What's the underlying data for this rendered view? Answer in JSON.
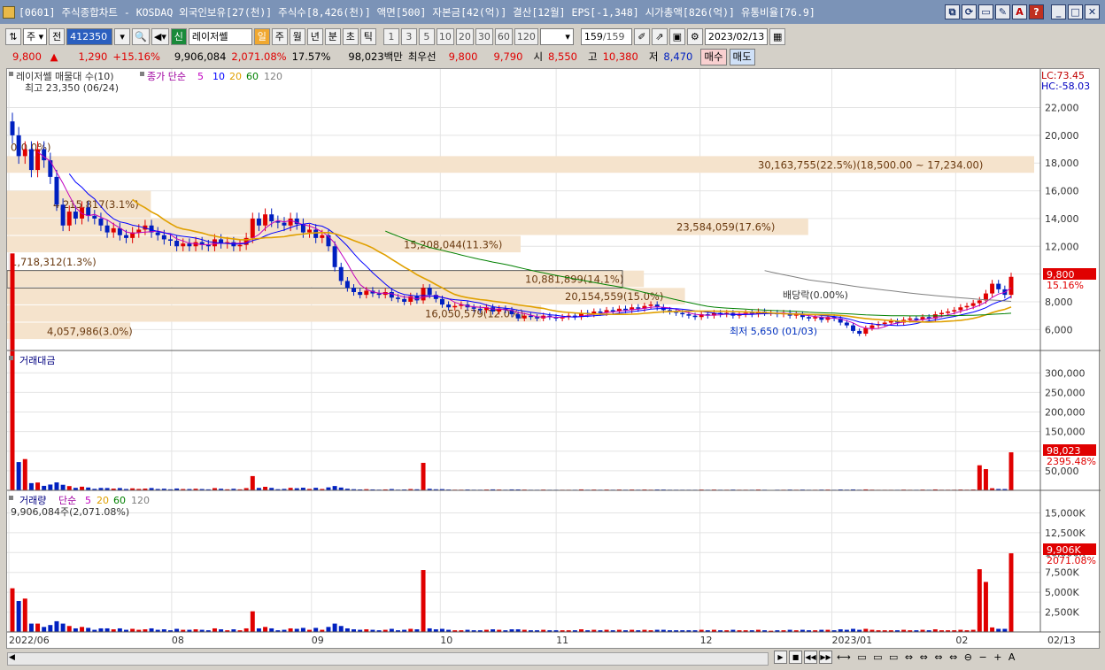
{
  "window": {
    "title": "[0601] 주식종합차트 - KOSDAQ 외국인보유[27(천)] 주식수[8,426(천)] 액면[500] 자본금[42(억)] 결산[12월] EPS[-1,348] 시가총액[826(억)] 유통비율[76.9]",
    "buttons": [
      "⧉",
      "⟳",
      "▭",
      "✎",
      "A",
      "?",
      "_",
      "□",
      "✕"
    ]
  },
  "toolbar": {
    "type_select": "주",
    "prev_label": "전",
    "code": "412350",
    "badge": "신",
    "stock_name": "레이저쎌",
    "periods": [
      "일",
      "주",
      "월",
      "년",
      "분",
      "초",
      "틱"
    ],
    "intervals": [
      "1",
      "3",
      "5",
      "10",
      "20",
      "30",
      "60",
      "120"
    ],
    "count": "159",
    "total": "/159",
    "date": "2023/02/13"
  },
  "quote": {
    "price": "9,800",
    "arrow": "▲",
    "change": "1,290",
    "change_pct": "+15.16%",
    "volume": "9,906,084",
    "volume_pct": "2,071.08%",
    "turnover": "17.57%",
    "amount": "98,023백만",
    "best_label": "최우선",
    "best_ask": "9,800",
    "best_bid": "9,790",
    "open_label": "시",
    "open": "8,550",
    "high_label": "고",
    "high": "10,380",
    "low_label": "저",
    "low": "8,470",
    "buy_label": "매수",
    "sell_label": "매도"
  },
  "chart_data": {
    "type": "candlestick",
    "x_labels": [
      "2022/06",
      "08",
      "09",
      "10",
      "11",
      "12",
      "2023/01",
      "02",
      "02/13"
    ],
    "price_panel": {
      "legend_name": "레이저쎌 매물대 수(10)",
      "ma_label": "종가 단순",
      "ma_periods": [
        "5",
        "10",
        "20",
        "60",
        "120"
      ],
      "ma_colors": [
        "#c000c0",
        "#0000ff",
        "#e0a000",
        "#008000",
        "#808080"
      ],
      "y_ticks": [
        "22,000",
        "20,000",
        "18,000",
        "16,000",
        "14,000",
        "12,000",
        "10,000",
        "8,000",
        "6,000"
      ],
      "ylim": [
        5000,
        23500
      ],
      "lc": "LC:73.45",
      "hc": "HC:-58.03",
      "high_note": "최고 23,350 (06/24)",
      "low_note": "최저 5,650 (01/03)",
      "dividend_note": "배당락(0.00%)",
      "last_price": "9,800",
      "last_pct": "15.16%",
      "volume_profile": [
        {
          "label": "30,163,755(22.5%)(18,500.00 ~ 17,234.00)",
          "lo": 17234,
          "hi": 18500
        },
        {
          "label": "23,584,059(17.6%)",
          "lo": 12750,
          "hi": 14000
        },
        {
          "label": "15,208,044(11.3%)",
          "lo": 11500,
          "hi": 12750
        },
        {
          "label": "1,718,312(1.3%)",
          "lo": 10250,
          "hi": 11500
        },
        {
          "label": "10,881,899(14.1%)",
          "lo": 9000,
          "hi": 10250
        },
        {
          "label": "20,154,559(15.0%)",
          "lo": 7750,
          "hi": 9000
        },
        {
          "label": "16,050,579(12.0%)",
          "lo": 6500,
          "hi": 7750
        },
        {
          "label": "4,057,986(3.0%)",
          "lo": 5250,
          "hi": 6500
        },
        {
          "label": "4,215,817(3.1%)",
          "lo": 14000,
          "hi": 16000
        },
        {
          "label": "0(0.0%)",
          "lo": 18500,
          "hi": 19750
        }
      ],
      "closes": [
        20000,
        18500,
        19000,
        17500,
        19000,
        18200,
        17000,
        15000,
        13500,
        14500,
        14000,
        14800,
        14200,
        14000,
        13500,
        13000,
        13300,
        12800,
        12600,
        13000,
        13200,
        13500,
        13000,
        12800,
        12500,
        12400,
        12000,
        12200,
        12000,
        12300,
        12100,
        12000,
        12500,
        12200,
        12300,
        12000,
        12100,
        12600,
        14000,
        13500,
        14300,
        13800,
        13700,
        13500,
        14000,
        13600,
        13000,
        13200,
        12600,
        12800,
        12000,
        10500,
        9500,
        9000,
        8700,
        8500,
        8800,
        8600,
        8500,
        8700,
        8300,
        8200,
        8000,
        8400,
        8100,
        9000,
        8500,
        8200,
        7800,
        7600,
        7700,
        7800,
        7600,
        7500,
        7400,
        7600,
        7300,
        7500,
        7400,
        7100,
        6800,
        7000,
        6900,
        6800,
        7000,
        6900,
        6800,
        6900,
        7000,
        6900,
        7200,
        7100,
        7300,
        7200,
        7400,
        7300,
        7500,
        7400,
        7600,
        7500,
        7700,
        7800,
        7600,
        7400,
        7300,
        7200,
        7100,
        7000,
        6900,
        7100,
        7000,
        7200,
        7100,
        7200,
        7000,
        7100,
        7200,
        7100,
        7300,
        7200,
        7200,
        7100,
        7200,
        7000,
        7100,
        6900,
        6800,
        6900,
        6700,
        6900,
        6800,
        6500,
        6300,
        5900,
        5700,
        6100,
        6300,
        6400,
        6500,
        6600,
        6500,
        6700,
        6800,
        6700,
        6900,
        6800,
        7100,
        7200,
        7300,
        7400,
        7600,
        7700,
        7900,
        8100,
        8600,
        9300,
        8900,
        8500,
        9800
      ]
    },
    "amount_panel": {
      "legend_name": "거래대금",
      "y_ticks": [
        "300,000",
        "250,000",
        "200,000",
        "150,000",
        "100,000",
        "50,000"
      ],
      "ylim": [
        0,
        330000
      ],
      "last_value": "98,023",
      "last_pct": "2395.48%"
    },
    "volume_panel": {
      "legend_name": "거래량",
      "ma_label": "단순",
      "ma_periods": [
        "5",
        "20",
        "60",
        "120"
      ],
      "volume_note": "9,906,084주(2,071.08%)",
      "y_ticks": [
        "15,000K",
        "12,500K",
        "10,000K",
        "7,500K",
        "5,000K",
        "2,500K"
      ],
      "ylim": [
        0,
        16500
      ],
      "last_value": "9,906K",
      "last_pct": "2071.08%"
    }
  }
}
